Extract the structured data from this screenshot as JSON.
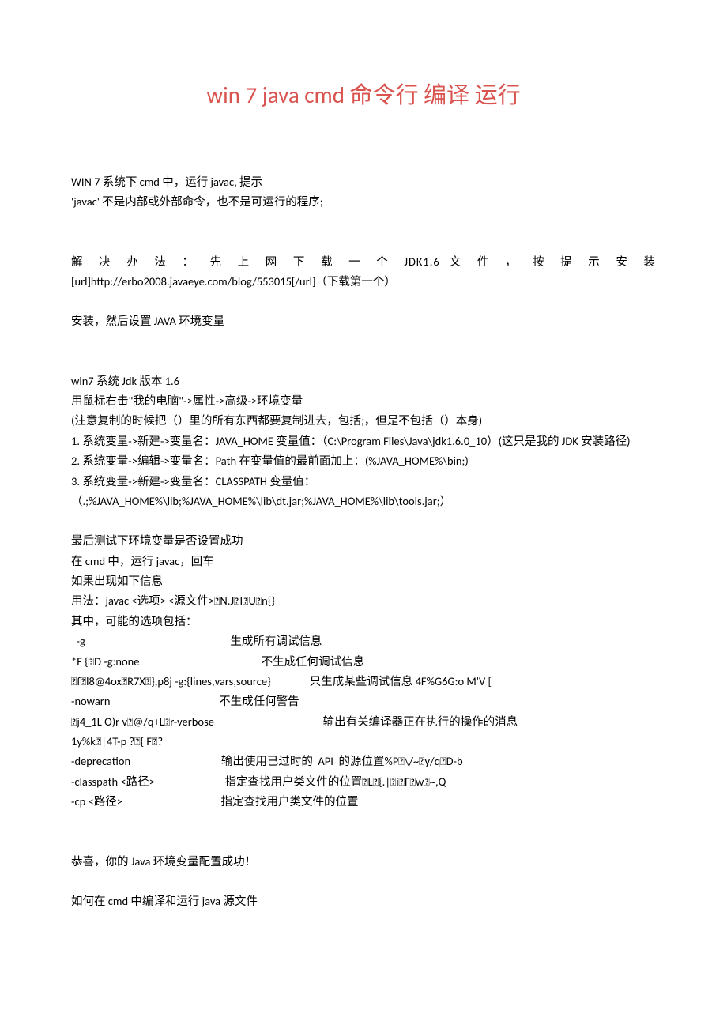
{
  "title": "win 7 java cmd  命令行  编译  运行",
  "p1": "WIN 7 系统下 cmd 中，运行 javac,  提示",
  "p2": " 'javac'  不是内部或外部命令，也不是可运行的程序;",
  "p3": "解 决 办 法 ： 先 上 网 下 载 一 个   JDK1.6   文 件 ， 按 提 示 安 装",
  "p4": "[url]http://erbo2008.javaeye.com/blog/553015[/url]（下载第一个）",
  "p5": "安装，然后设置 JAVA 环境变量",
  "p6": "win7 系统  Jdk 版本 1.6",
  "p7": "  用鼠标右击\"我的电脑\"->属性->高级->环境变量",
  "p8": "(注意复制的时候把（）里的所有东西都要复制进去，包括;，但是不包括（）本身)",
  "p9": "1.  系统变量->新建->变量名：JAVA_HOME  变量值：（C:\\Program Files\\Java\\jdk1.6.0_10）(这只是我的 JDK 安装路径)",
  "p10": "2.  系统变量->编辑->变量名：Path  在变量值的最前面加上：(%JAVA_HOME%\\bin;)",
  "p11": "3.  系统变量->新建->变量名：CLASSPATH  变量值：",
  "p12": "（.;%JAVA_HOME%\\lib;%JAVA_HOME%\\lib\\dt.jar;%JAVA_HOME%\\lib\\tools.jar;）",
  "p13": "最后测试下环境变量是否设置成功",
  "p14": "在 cmd 中，运行 javac，回车",
  "p15": "如果出现如下信息",
  "p16": "用法：javac <选项> <源文件>￿N.J￿I￿U￿n{}",
  "p17": "其中，可能的选项包括：",
  "opt1": "  -g                                                        生成所有调试信息",
  "opt2": "*F {￿D -g:none                                               不生成任何调试信息",
  "opt3": "￿f￿l8@4ox￿R7X￿},p8j -g:{lines,vars,source}               只生成某些调试信息 4F%G6G:o M'V [",
  "opt4": "-nowarn                                          不生成任何警告",
  "opt5": "￿j4_1L O)r v￿@/q+L￿r-verbose                                          输出有关编译器正在执行的操作的消息",
  "opt6": "1y%k￿|4T-p ?￿{ F￿?",
  "opt7": "-deprecation                                   输出使用已过时的  API  的源位置%P￿\\/~￿y/q￿D-b",
  "opt8": "-classpath <路径>                           指定查找用户类文件的位置￿L￿{.|￿i￿F￿w￿~,Q",
  "opt9": "-cp <路径>                                      指定查找用户类文件的位置",
  "p18": "  恭喜，你的 Java 环境变量配置成功！",
  "p19": "如何在 cmd 中编译和运行 java 源文件"
}
